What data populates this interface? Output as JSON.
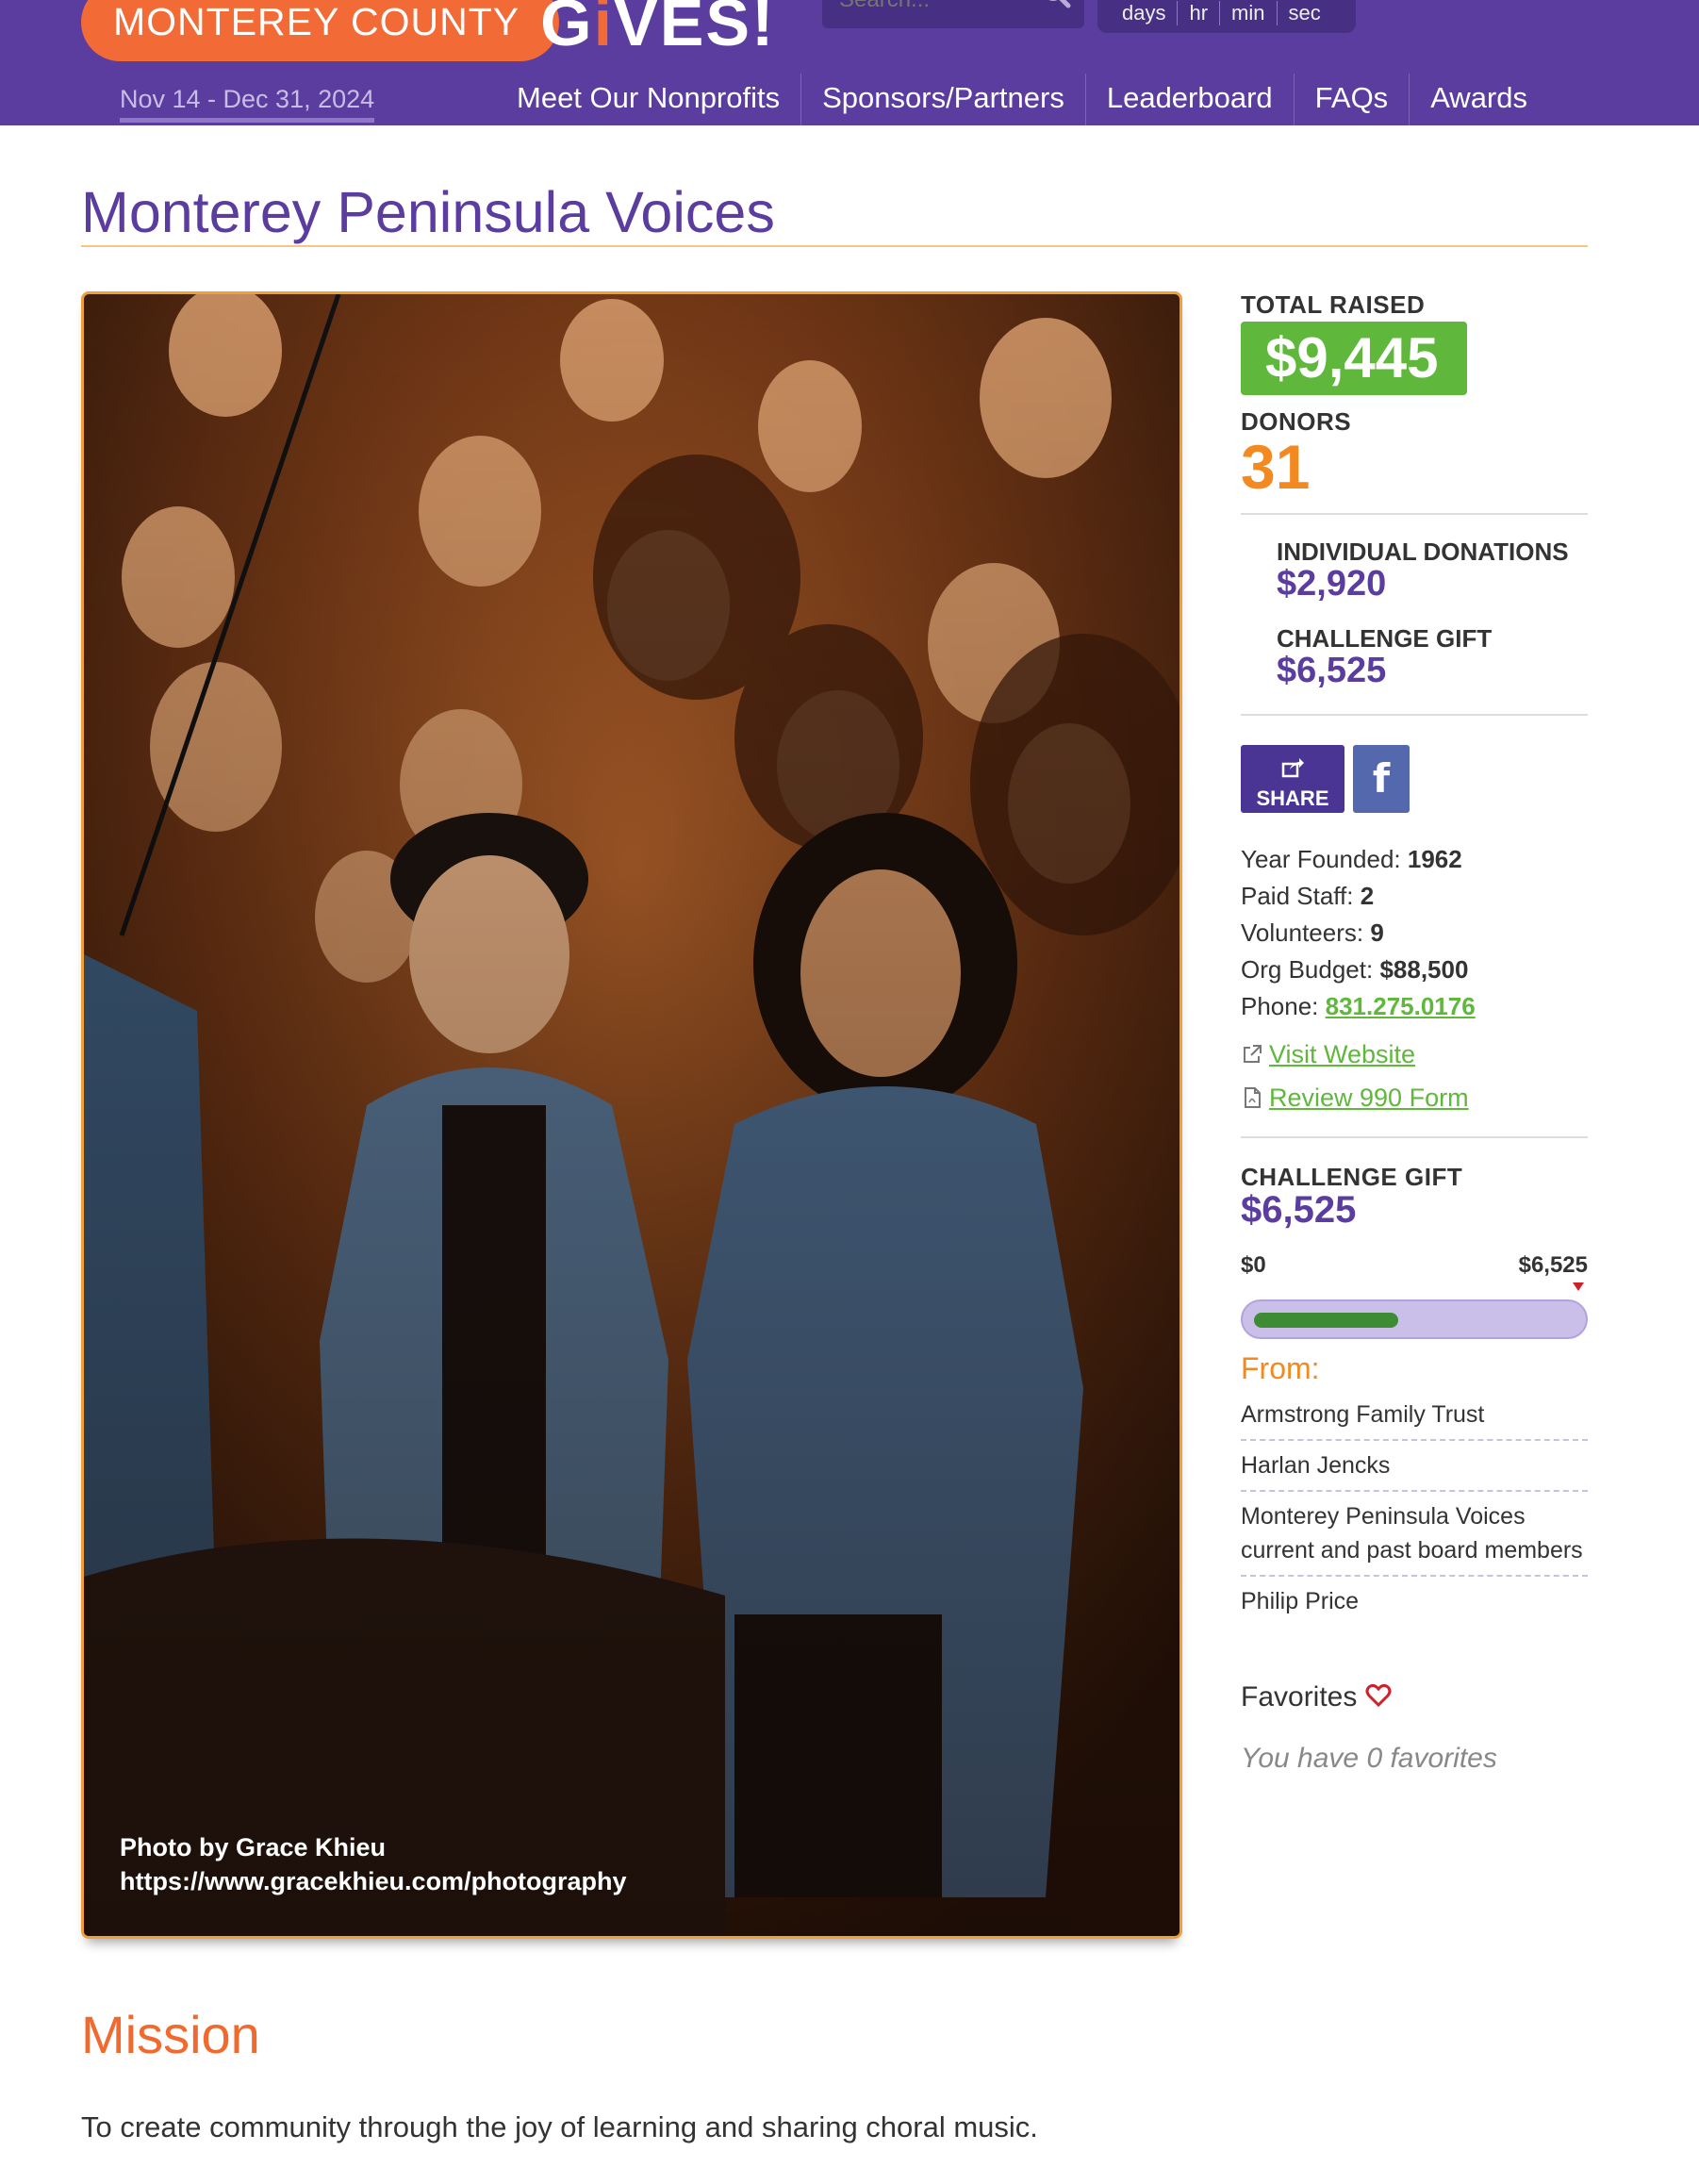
{
  "header": {
    "logo_county": "MONTEREY COUNTY",
    "logo_gives_pre": "G",
    "logo_gives_i": "i",
    "logo_gives_post": "VES!",
    "date_range": "Nov 14 - Dec 31, 2024",
    "search_placeholder": "Search...",
    "countdown": [
      "days",
      "hr",
      "min",
      "sec"
    ],
    "nav": [
      "Meet Our Nonprofits",
      "Sponsors/Partners",
      "Leaderboard",
      "FAQs",
      "Awards"
    ]
  },
  "page": {
    "title": "Monterey Peninsula Voices"
  },
  "photo": {
    "credit_line1": "Photo by Grace Khieu",
    "credit_line2": "https://www.gracekhieu.com/photography"
  },
  "stats": {
    "total_raised_label": "TOTAL RAISED",
    "total_raised": "$9,445",
    "donors_label": "DONORS",
    "donors": "31",
    "individual_label": "INDIVIDUAL DONATIONS",
    "individual": "$2,920",
    "challenge_label": "CHALLENGE GIFT",
    "challenge": "$6,525"
  },
  "share": {
    "share_label": "SHARE",
    "facebook_label": "f"
  },
  "facts": {
    "year_label": "Year Founded:",
    "year": "1962",
    "staff_label": "Paid Staff:",
    "staff": "2",
    "volunteers_label": "Volunteers:",
    "volunteers": "9",
    "budget_label": "Org Budget:",
    "budget": "$88,500",
    "phone_label": "Phone:",
    "phone": "831.275.0176",
    "website_link": "Visit Website",
    "form_link": "Review 990 Form"
  },
  "challenge_gift": {
    "label": "CHALLENGE GIFT",
    "amount": "$6,525",
    "min_label": "$0",
    "max_label": "$6,525",
    "progress_fraction": 0.45,
    "from_label": "From:",
    "donors": [
      "Armstrong Family Trust",
      "Harlan Jencks",
      "Monterey Peninsula Voices current and past board members",
      "Philip Price"
    ]
  },
  "favorites": {
    "label": "Favorites",
    "note": "You have 0 favorites"
  },
  "mission": {
    "heading": "Mission",
    "text": "To create community through the joy of learning and sharing choral music."
  },
  "colors": {
    "header_purple": "#5a3d9e",
    "brand_orange": "#f26a35",
    "raised_green": "#5fb83b",
    "donor_orange": "#f28a21",
    "link_green": "#5fb83b"
  }
}
